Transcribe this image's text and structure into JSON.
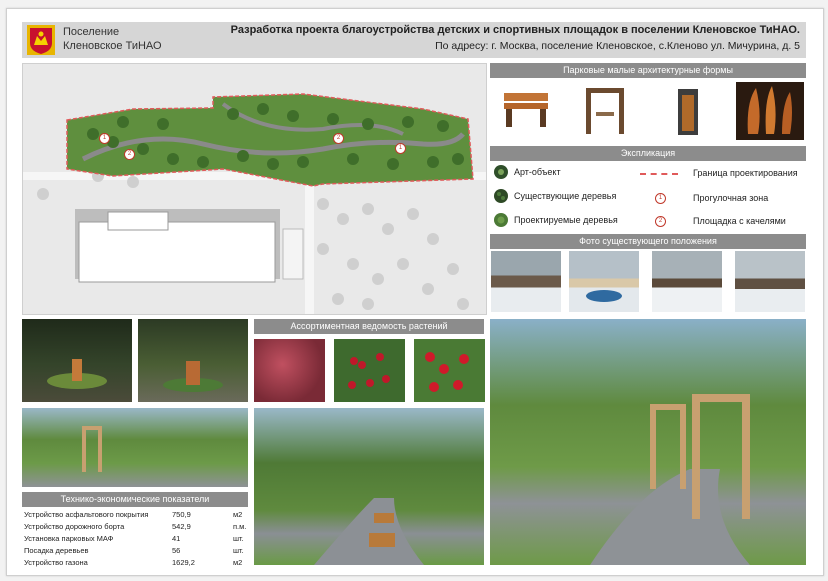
{
  "header": {
    "municipality_line1": "Поселение",
    "municipality_line2": "Кленовское ТиНАО",
    "title": "Разработка проекта благоустройства детских и спортивных площадок в поселении Кленовское ТиНАО.",
    "address": "По адресу: г. Москва, поселение Кленовское, с.Кленово ул. Мичурина, д. 5"
  },
  "sections": {
    "small_forms": "Парковые малые архитектурные формы",
    "explication": "Экспликация",
    "existing_photos": "Фото существующего положения",
    "plants": "Ассортиментная ведомость растений",
    "indicators": "Технико-экономические показатели"
  },
  "legend": [
    {
      "label": "Арт-объект",
      "symbol": "art-object"
    },
    {
      "label": "Граница проектирования",
      "symbol": "boundary-line"
    },
    {
      "label": "Существующие деревья",
      "symbol": "existing-tree"
    },
    {
      "label": "Прогулочная зона",
      "symbol": "marker",
      "marker": "1"
    },
    {
      "label": "Проектируемые деревья",
      "symbol": "planned-tree"
    },
    {
      "label": "Площадка с качелями",
      "symbol": "marker",
      "marker": "2"
    }
  ],
  "plan_markers": [
    "1",
    "2",
    "2",
    "1"
  ],
  "indicators": [
    {
      "name": "Устройство асфальтового покрытия",
      "value": "750,9",
      "unit": "м2"
    },
    {
      "name": "Устройство дорожного борта",
      "value": "542,9",
      "unit": "п.м."
    },
    {
      "name": "Установка парковых МАФ",
      "value": "41",
      "unit": "шт."
    },
    {
      "name": "Посадка деревьев",
      "value": "56",
      "unit": "шт."
    },
    {
      "name": "Устройство газона",
      "value": "1629,2",
      "unit": "м2"
    }
  ],
  "colors": {
    "header_bg": "#d6d6d6",
    "section_header": "#8c8c8c",
    "boundary": "#e05a5a",
    "lawn": "#5f8f3e",
    "path": "#8a8a8a"
  }
}
